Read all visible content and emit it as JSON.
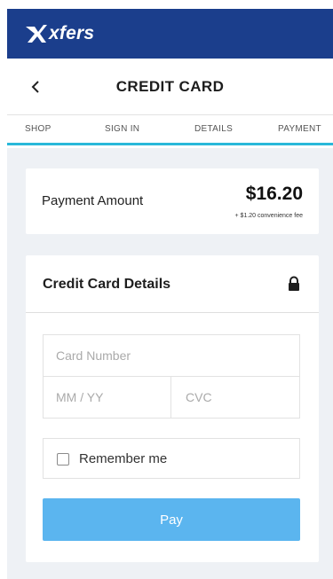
{
  "app": {
    "brand": "xfers",
    "logo_icon": "xfers-logo-icon"
  },
  "header": {
    "title": "CREDIT CARD",
    "back_icon": "chevron-left-icon"
  },
  "steps": [
    {
      "label": "SHOP"
    },
    {
      "label": "SIGN IN"
    },
    {
      "label": "DETAILS"
    },
    {
      "label": "PAYMENT"
    }
  ],
  "payment": {
    "label": "Payment Amount",
    "amount": "$16.20",
    "fee_note": "+ $1.20 convenience fee"
  },
  "card_details": {
    "title": "Credit Card Details",
    "lock_icon": "lock-icon",
    "card_number_placeholder": "Card Number",
    "expiry_placeholder": "MM / YY",
    "cvc_placeholder": "CVC",
    "remember_label": "Remember me",
    "remember_checked": false,
    "pay_label": "Pay"
  },
  "colors": {
    "brand_blue": "#1b3e8c",
    "step_accent": "#29b8d9",
    "pay_button": "#5bb5ef",
    "background": "#eef1f5"
  }
}
